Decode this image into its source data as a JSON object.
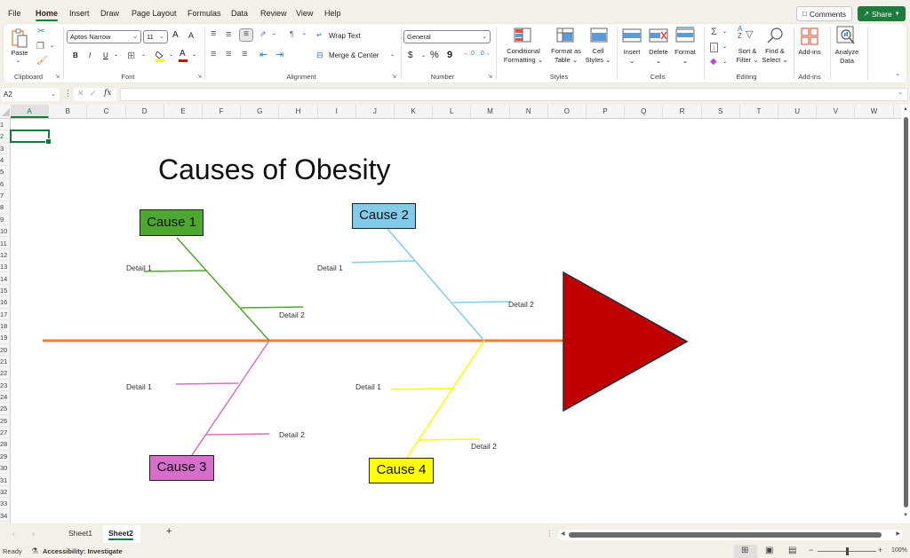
{
  "menu": {
    "tabs": [
      "File",
      "Home",
      "Insert",
      "Draw",
      "Page Layout",
      "Formulas",
      "Data",
      "Review",
      "View",
      "Help"
    ],
    "active": "Home",
    "comments_label": "Comments",
    "share_label": "Share"
  },
  "ribbon": {
    "clipboard": {
      "paste": "Paste",
      "group": "Clipboard"
    },
    "font": {
      "name": "Aptos Narrow",
      "size": "11",
      "group": "Font",
      "bold": "B",
      "italic": "I",
      "underline": "U",
      "grow": "A",
      "shrink": "A",
      "font_color_glyph": "A",
      "highlight_color": "#ffff00",
      "font_color": "#e00000"
    },
    "alignment": {
      "wrap": "Wrap Text",
      "merge": "Merge & Center",
      "group": "Alignment"
    },
    "number": {
      "format": "General",
      "group": "Number",
      "currency": "$",
      "percent": "%",
      "comma": "9"
    },
    "styles": {
      "conditional": [
        "Conditional",
        "Formatting"
      ],
      "format_table": [
        "Format as",
        "Table"
      ],
      "cell_styles": [
        "Cell",
        "Styles"
      ],
      "group": "Styles"
    },
    "cells": {
      "insert": "Insert",
      "delete": "Delete",
      "format": "Format",
      "group": "Cells"
    },
    "editing": {
      "sort": [
        "Sort &",
        "Filter"
      ],
      "find": [
        "Find &",
        "Select"
      ],
      "group": "Editing",
      "sum": "Σ"
    },
    "addins": {
      "label": "Add-ins",
      "group": "Add-ins"
    },
    "analyze": {
      "label": [
        "Analyze",
        "Data"
      ]
    }
  },
  "formula_bar": {
    "name_box": "A2",
    "fx": "fx",
    "value": ""
  },
  "grid": {
    "columns": [
      "A",
      "B",
      "C",
      "D",
      "E",
      "F",
      "G",
      "H",
      "I",
      "J",
      "K",
      "L",
      "M",
      "N",
      "O",
      "P",
      "Q",
      "R",
      "S",
      "T",
      "U",
      "V",
      "W"
    ],
    "selected_column": "A",
    "rows": [
      "1",
      "2",
      "3",
      "4",
      "5",
      "6",
      "7",
      "8",
      "9",
      "10",
      "11",
      "12",
      "13",
      "14",
      "15",
      "16",
      "17",
      "18",
      "19",
      "20",
      "21",
      "22",
      "23",
      "24",
      "25",
      "26",
      "27",
      "28",
      "29",
      "30",
      "31",
      "32",
      "33",
      "34"
    ],
    "selected_row": "2",
    "selected_cell": "A2"
  },
  "diagram": {
    "title": "Causes of Obesity",
    "spine_color": "#ed7d31",
    "head_color": "#c00000",
    "causes": [
      {
        "label": "Cause 1",
        "fill": "#4ea72e",
        "line": "#4ea72e",
        "details": [
          "Detail 1",
          "Detail 2"
        ]
      },
      {
        "label": "Cause 2",
        "fill": "#83cbeb",
        "line": "#83cbeb",
        "details": [
          "Detail 1",
          "Detail 2"
        ]
      },
      {
        "label": "Cause 3",
        "fill": "#d86ecc",
        "line": "#d86ecc",
        "details": [
          "Detail 1",
          "Detail 2"
        ]
      },
      {
        "label": "Cause 4",
        "fill": "#ffff00",
        "line": "#ffff00",
        "details": [
          "Detail 1",
          "Detail 2"
        ]
      }
    ]
  },
  "sheets": {
    "tabs": [
      "Sheet1",
      "Sheet2"
    ],
    "active": "Sheet2",
    "add": "+"
  },
  "status": {
    "ready": "Ready",
    "accessibility": "Accessibility: Investigate",
    "zoom": "100%",
    "zoom_fraction": 0.5
  }
}
